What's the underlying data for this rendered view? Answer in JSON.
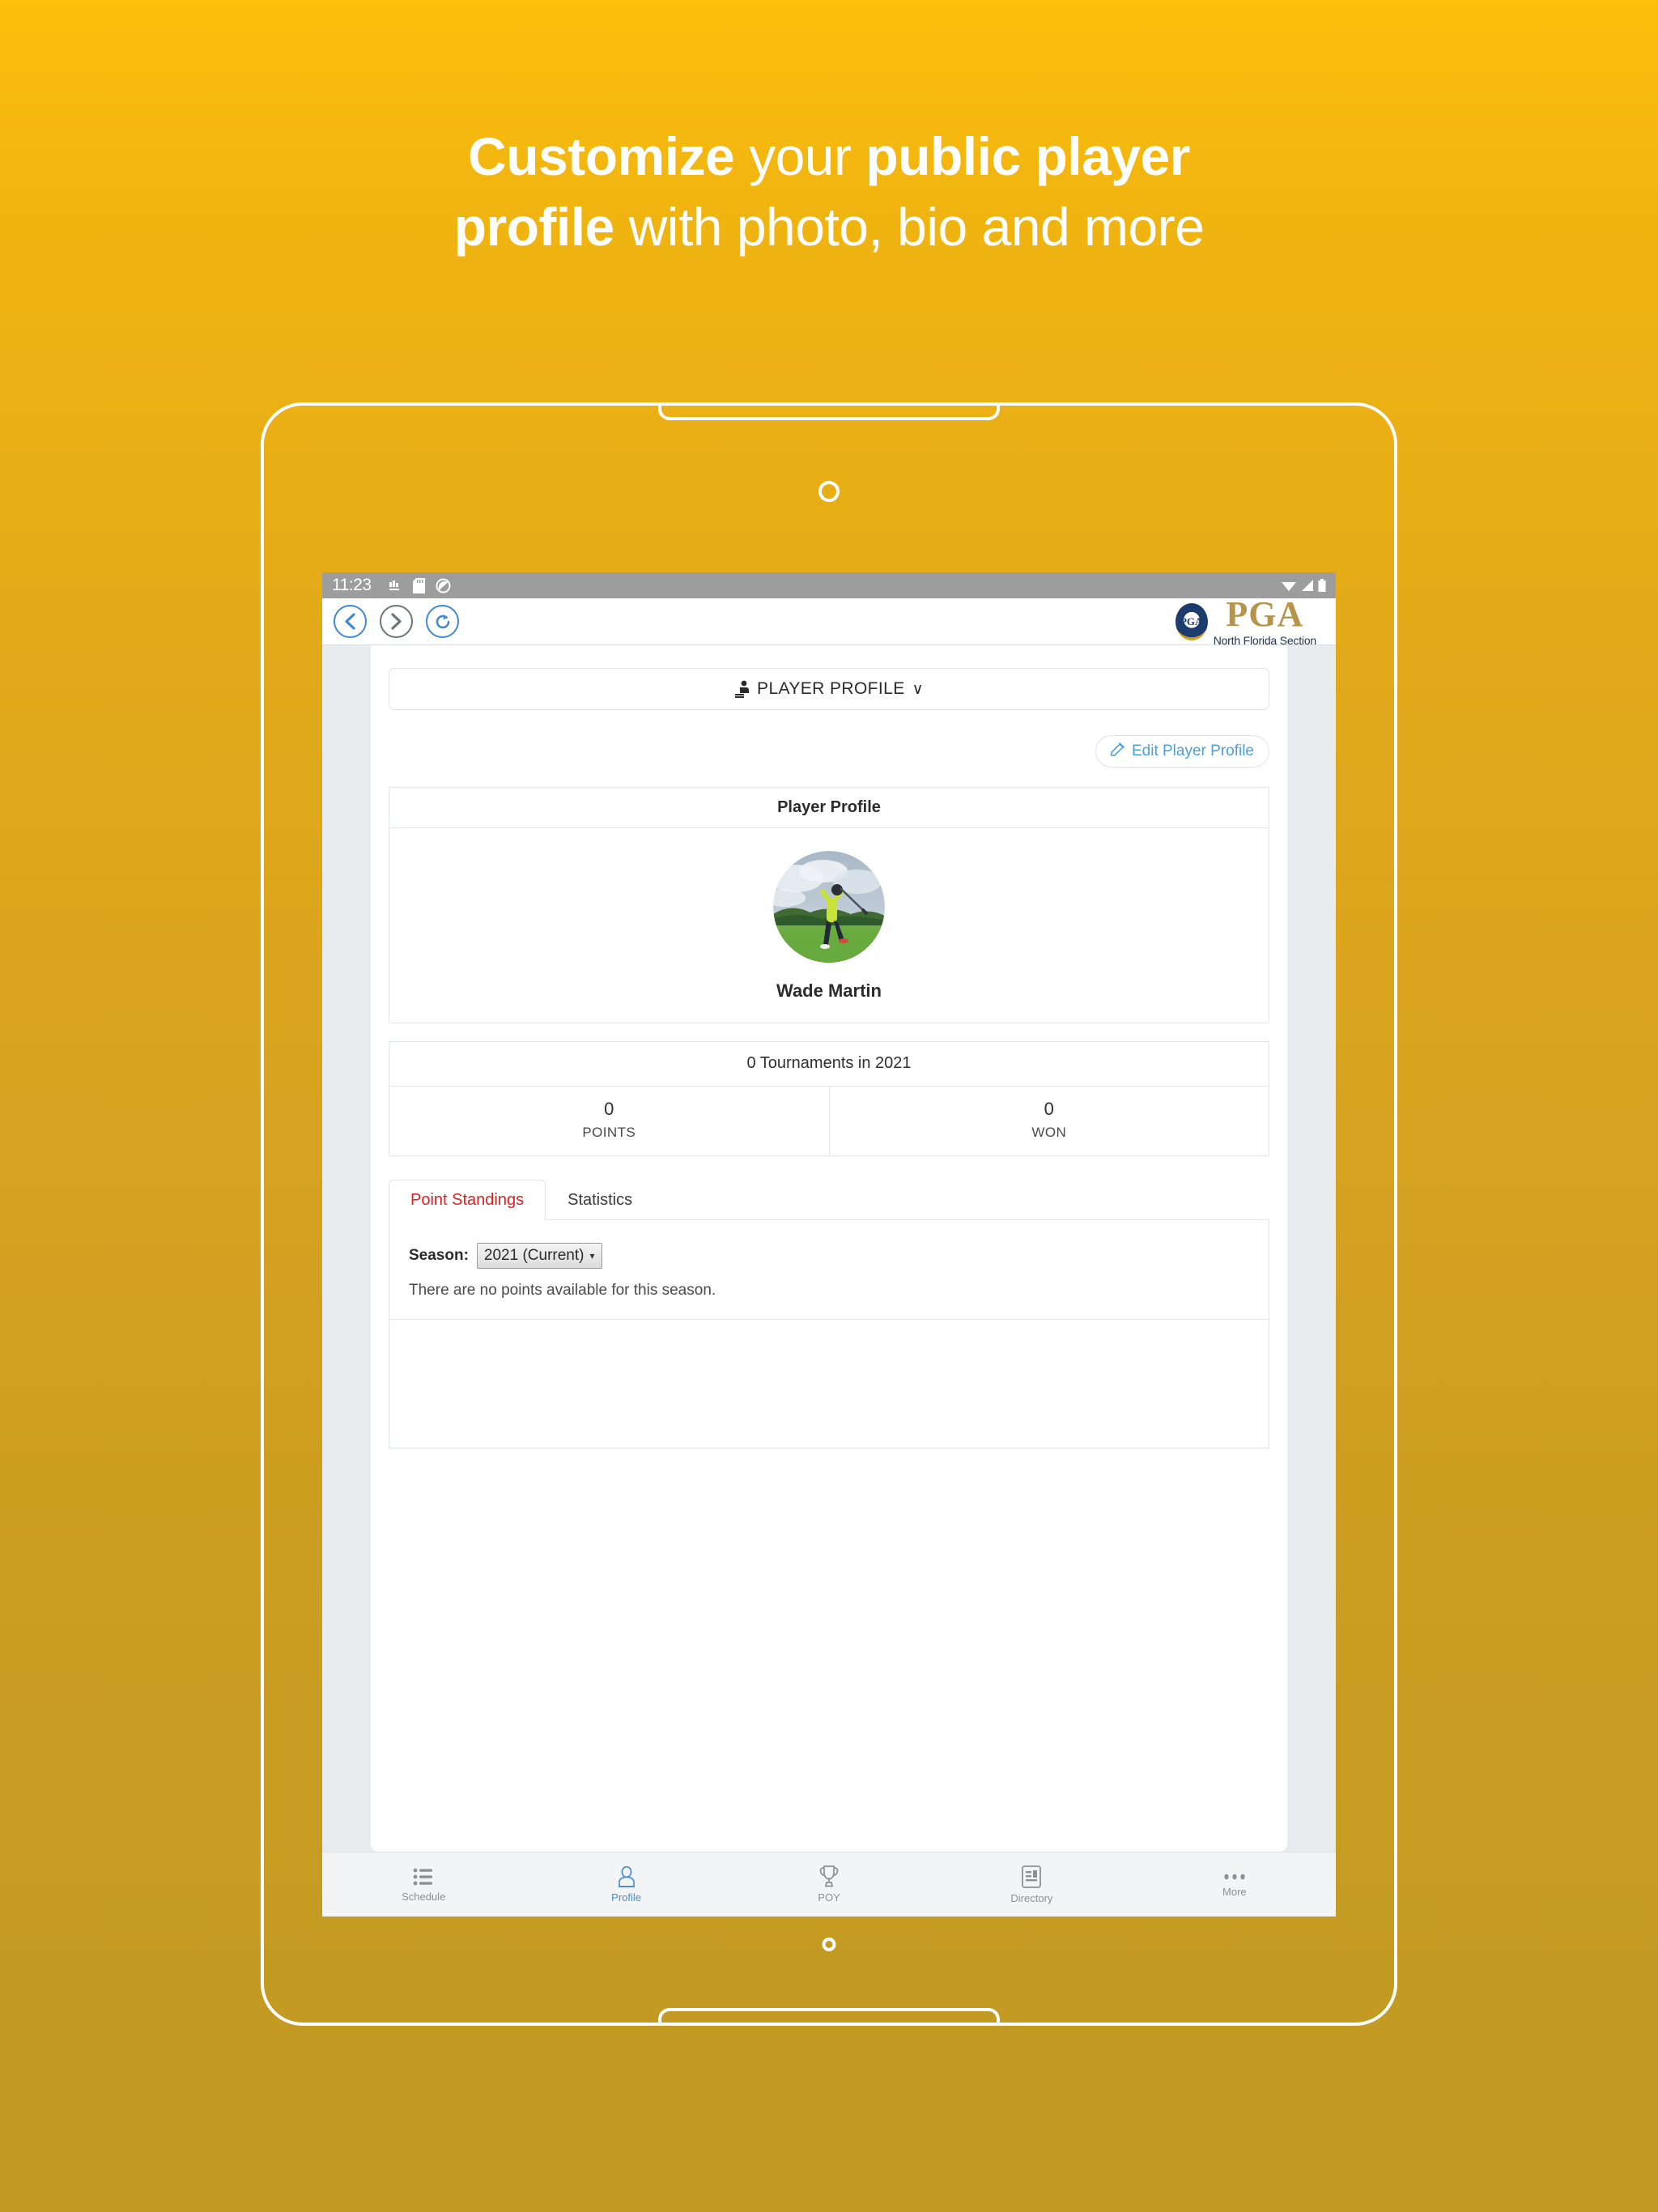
{
  "promo": {
    "line1_bold": "Customize",
    "line1_rest": " your ",
    "line1_bold2": "public player",
    "line2_bold": "profile",
    "line2_rest": " with photo, bio and more"
  },
  "status_bar": {
    "time": "11:23",
    "left_icons": [
      "app-icon",
      "sd-card-icon",
      "do-not-disturb-icon"
    ],
    "right_icons": [
      "wifi-icon",
      "signal-icon",
      "battery-icon"
    ]
  },
  "browser": {
    "back_label": "Back",
    "forward_label": "Forward",
    "reload_label": "Reload",
    "logo": {
      "seal_text": "PGA",
      "wordmark": "PGA",
      "subtitle": "North Florida Section",
      "gold": "#b79449",
      "navy": "#1d3c6e"
    }
  },
  "page": {
    "section_selector": "PLAYER PROFILE",
    "section_selector_caret": "∨",
    "edit_button": "Edit Player Profile",
    "profile_panel": {
      "header": "Player Profile",
      "player_name": "Wade Martin",
      "avatar": "golfer-swing-photo"
    },
    "stats": {
      "title": "0 Tournaments in 2021",
      "cells": [
        {
          "value": "0",
          "label": "POINTS"
        },
        {
          "value": "0",
          "label": "WON"
        }
      ]
    },
    "tabs": [
      {
        "label": "Point Standings",
        "active": true
      },
      {
        "label": "Statistics",
        "active": false
      }
    ],
    "season": {
      "label": "Season:",
      "selected": "2021 (Current)",
      "caret": "▾"
    },
    "empty_message": "There are no points available for this season."
  },
  "bottom_nav": [
    {
      "label": "Schedule",
      "icon": "list-icon",
      "active": false
    },
    {
      "label": "Profile",
      "icon": "person-icon",
      "active": true
    },
    {
      "label": "POY",
      "icon": "trophy-icon",
      "active": false
    },
    {
      "label": "Directory",
      "icon": "directory-card-icon",
      "active": false
    },
    {
      "label": "More",
      "icon": "ellipsis-icon",
      "active": false
    }
  ],
  "theme": {
    "bg_top": "#FDBE0C",
    "bg_bottom": "#C19A23",
    "accent_red": "#e02020",
    "accent_blue": "#4a9fe0",
    "screen_bg": "#e8ecef"
  }
}
